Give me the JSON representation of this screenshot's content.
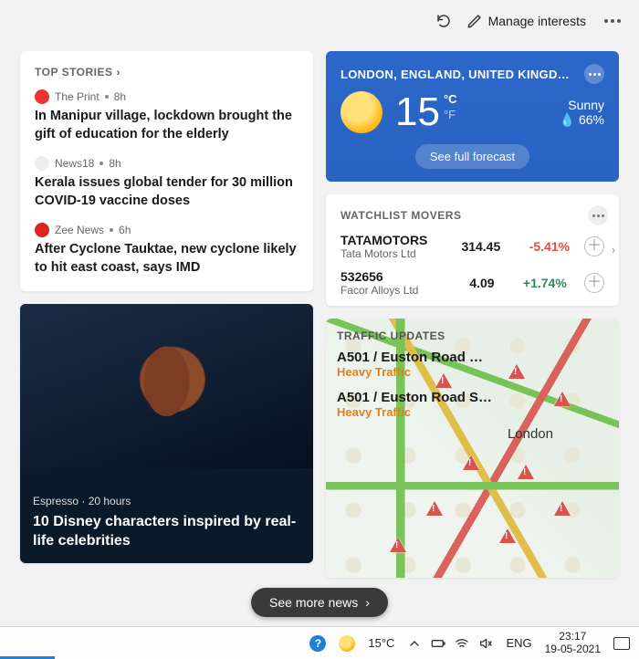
{
  "toolbar": {
    "manage_label": "Manage interests"
  },
  "top_stories": {
    "header": "TOP STORIES",
    "items": [
      {
        "source": "The Print",
        "age": "8h",
        "title": "In Manipur village, lockdown brought the gift of education for the elderly"
      },
      {
        "source": "News18",
        "age": "8h",
        "title": "Kerala issues global tender for 30 million COVID-19 vaccine doses"
      },
      {
        "source": "Zee News",
        "age": "6h",
        "title": "After Cyclone Tauktae, new cyclone likely to hit east coast, says IMD"
      }
    ]
  },
  "feature": {
    "source": "Espresso",
    "age": "20 hours",
    "title": "10 Disney characters inspired by real-life celebrities"
  },
  "weather": {
    "location": "LONDON, ENGLAND, UNITED KINGD…",
    "temp": "15",
    "unit_c": "°C",
    "unit_f": "°F",
    "condition": "Sunny",
    "humidity": "66%",
    "forecast_label": "See full forecast"
  },
  "watchlist": {
    "header": "WATCHLIST MOVERS",
    "items": [
      {
        "symbol": "TATAMOTORS",
        "company": "Tata Motors Ltd",
        "price": "314.45",
        "change": "-5.41%",
        "dir": "neg"
      },
      {
        "symbol": "532656",
        "company": "Facor Alloys Ltd",
        "price": "4.09",
        "change": "+1.74%",
        "dir": "pos"
      }
    ]
  },
  "traffic": {
    "header": "TRAFFIC UPDATES",
    "city_label": "London",
    "items": [
      {
        "road": "A501 / Euston Road …",
        "status": "Heavy Traffic"
      },
      {
        "road": "A501 / Euston Road S…",
        "status": "Heavy Traffic"
      }
    ]
  },
  "see_more_label": "See more news",
  "taskbar": {
    "temp": "15°C",
    "lang": "ENG",
    "time": "23:17",
    "date": "19-05-2021"
  }
}
